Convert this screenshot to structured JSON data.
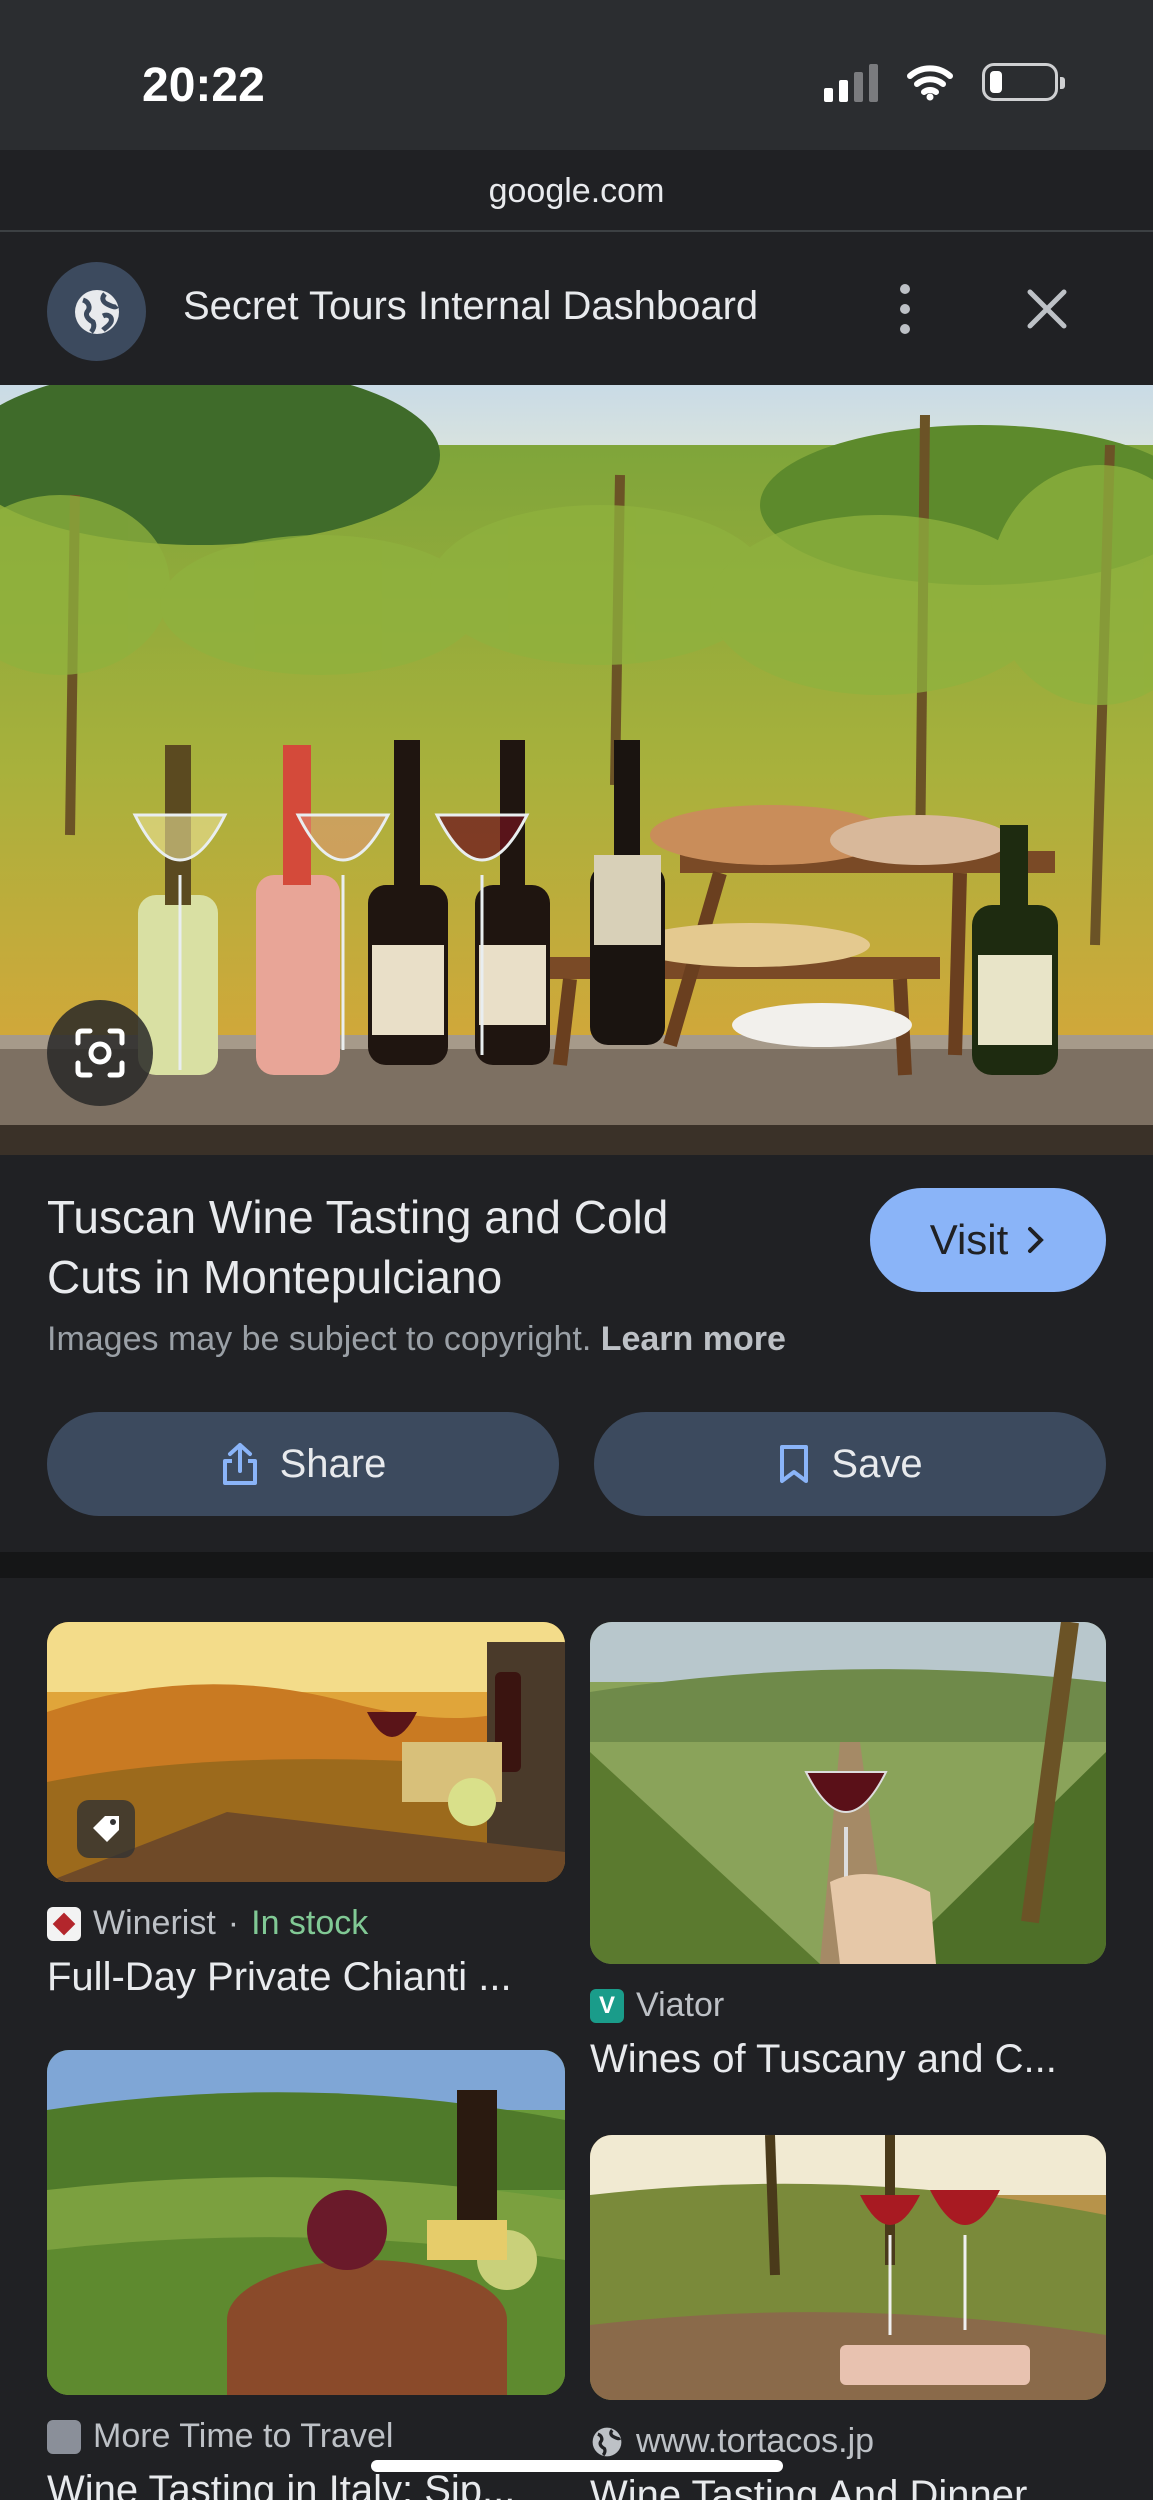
{
  "status": {
    "time": "20:22"
  },
  "browser": {
    "url": "google.com"
  },
  "topbar": {
    "title": "Secret Tours Internal Dashboard"
  },
  "result": {
    "title": "Tuscan Wine Tasting and Cold Cuts in Montepulciano",
    "visit_label": "Visit",
    "copyright_text": "Images may be subject to copyright.",
    "learn_more": "Learn more",
    "share_label": "Share",
    "save_label": "Save"
  },
  "related": [
    {
      "source": "Winerist",
      "separator": "·",
      "availability": "In stock",
      "title": "Full-Day Private Chianti ..."
    },
    {
      "source": "Viator",
      "title": "Wines of Tuscany and C..."
    },
    {
      "source": "More Time to Travel",
      "title": "Wine Tasting in Italy: Sip..."
    },
    {
      "source": "www.tortacos.jp",
      "title": "Wine Tasting And Dinner..."
    }
  ],
  "colors": {
    "accent": "#8ab4f8",
    "background": "#202124",
    "button": "#3c4a5e",
    "in_stock": "#81c995"
  },
  "icons": [
    "globe-icon",
    "more-vert-icon",
    "close-icon",
    "lens-icon",
    "share-icon",
    "bookmark-icon",
    "tag-icon",
    "chevron-right-icon"
  ]
}
